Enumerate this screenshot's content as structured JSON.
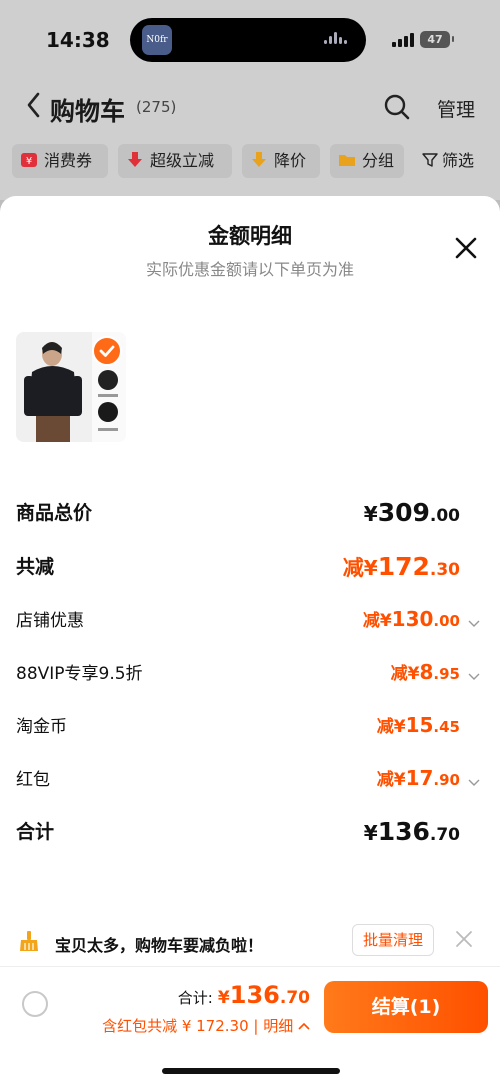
{
  "status_bar": {
    "time": "14:38",
    "battery": "47",
    "island_app_text": "N0fr"
  },
  "nav": {
    "title": "购物车",
    "count": "(275)",
    "manage": "管理"
  },
  "filters": [
    {
      "label": "消费券",
      "icon": "coupon-icon"
    },
    {
      "label": "超级立减",
      "icon": "down-arrow-icon"
    },
    {
      "label": "降价",
      "icon": "price-drop-icon"
    },
    {
      "label": "分组",
      "icon": "folder-icon"
    },
    {
      "label": "筛选",
      "icon": "filter-icon"
    }
  ],
  "sheet": {
    "title": "金额明细",
    "subtitle": "实际优惠金额请以下单页为准",
    "rows": [
      {
        "label": "商品总价",
        "prefix": "",
        "yen": "¥",
        "int": "309",
        "dec": ".00",
        "style": "total"
      },
      {
        "label": "共减",
        "prefix": "减",
        "yen": "¥",
        "int": "172",
        "dec": ".30",
        "style": "reduce-total"
      },
      {
        "label": "店铺优惠",
        "prefix": "减",
        "yen": "¥",
        "int": "130",
        "dec": ".00",
        "style": "item",
        "expandable": true
      },
      {
        "label": "88VIP专享9.5折",
        "prefix": "减",
        "yen": "¥",
        "int": "8",
        "dec": ".95",
        "style": "item",
        "expandable": true
      },
      {
        "label": "淘金币",
        "prefix": "减",
        "yen": "¥",
        "int": "15",
        "dec": ".45",
        "style": "item",
        "expandable": false
      },
      {
        "label": "红包",
        "prefix": "减",
        "yen": "¥",
        "int": "17",
        "dec": ".90",
        "style": "item",
        "expandable": true
      },
      {
        "label": "合计",
        "prefix": "",
        "yen": "¥",
        "int": "136",
        "dec": ".70",
        "style": "total"
      }
    ]
  },
  "tip": {
    "text": "宝贝太多，购物车要减负啦！",
    "button": "批量清理"
  },
  "checkout": {
    "total_label": "合计:",
    "total_yen": "¥",
    "total_int": "136",
    "total_dec": ".70",
    "discount_text": "含红包共减 ¥ 172.30 | 明细",
    "button": "结算(1)"
  },
  "colors": {
    "accent": "#ff5000",
    "text": "#111111",
    "muted": "#888888"
  }
}
